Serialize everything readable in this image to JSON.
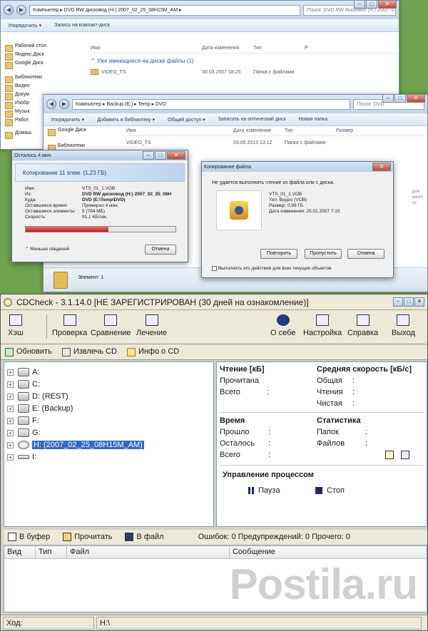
{
  "explorer_back": {
    "address": "Компьютер ▸ DVD RW дисковод (H:) 2007_02_25_08H15M_AM ▸",
    "search": "Поиск: DVD RW дисковод (H:) 2007_0...",
    "cmd": [
      "Упорядочить ▾",
      "Запись на компакт-диск"
    ],
    "sidebar": [
      "Рабочий стол",
      "Яндекс.Диск",
      "Google Диск",
      "Библиотеки",
      "Видео",
      "Докум",
      "Изобр",
      "Музык",
      "Работ",
      "Домаш"
    ],
    "columns": [
      "Имя",
      "Дата изменения",
      "Тип",
      "Р"
    ],
    "group": "Уже имеющиеся на диске файлы (1)",
    "row": {
      "name": "VIDEO_TS",
      "date": "30.03.2007 18:25",
      "type": "Папка с файлами"
    }
  },
  "explorer_front": {
    "address": "Компьютер ▸ Backup (E:) ▸ Temp ▸ DVD",
    "search": "Поиск: DVD",
    "cmd": [
      "Упорядочить ▾",
      "Добавить в библиотеку ▾",
      "Общий доступ ▾",
      "Записать на оптический диск",
      "Новая папка"
    ],
    "sidebar": [
      "Google Диск",
      "Библиотеки"
    ],
    "columns": [
      "Имя",
      "Дата изменения",
      "Тип",
      "Размер"
    ],
    "row": {
      "name": "VIDEO_TS",
      "date": "03.05.2013 13:12",
      "type": "Папка с файлами"
    },
    "status": "Элемент: 1",
    "side_hint": "для\nнного\nто"
  },
  "copy_dialog": {
    "title": "Осталось 4 мин.",
    "header": "Копирование 11 элем. (1,23 ГБ)",
    "labels": [
      "Имя:",
      "Из:",
      "Куда:",
      "Оставшееся время:",
      "Оставшиеся элементы:",
      "Скорость:"
    ],
    "values": [
      "VTS_01_1.VOB",
      "DVD RW дисковод (H:) 2007_02_25_08H",
      "DVD (E:\\Temp\\DVD)",
      "Примерно 4 мин.",
      "5 (784 МБ)",
      "91,1 КБ/сек."
    ],
    "progress": 0.55,
    "less": "Меньше сведений",
    "cancel": "Отмена"
  },
  "error_dialog": {
    "title": "Копирование файла",
    "message": "Не удается выполнить чтение из файла или с диска.",
    "file": "VTS_01_1.VOB",
    "type": "Тип: Видео (VOB)",
    "size": "Размер: 0,99 ГБ",
    "date": "Дата изменения: 25.02.2007 7:15",
    "retry": "Повторить",
    "skip": "Пропустить",
    "cancel": "Отмена",
    "check": "Выполнять это действие для всех текущих объектов"
  },
  "cdcheck": {
    "title": "CDCheck - 3.1.14.0 [НЕ ЗАРЕГИСТРИРОВАН (30 дней на ознакомление)]",
    "toolbar": [
      "Хэш",
      "Проверка",
      "Сравнение",
      "Лечение",
      "О себе",
      "Настройка",
      "Справка",
      "Выход"
    ],
    "toolbar2": [
      "Обновить",
      "Извлечь CD",
      "Инфо о CD"
    ],
    "drives": [
      "A:",
      "C:",
      "D: (REST)",
      "E: (Backup)",
      "F:",
      "G:",
      "H: (2007_02_25_08H15M_AM)",
      "I:"
    ],
    "selected_drive": "H: (2007_02_25_08H15M_AM)",
    "read_title": "Чтение [кБ]",
    "read_rows": [
      "Прочитана",
      "Всего"
    ],
    "speed_title": "Средняя скорость [кБ/с]",
    "speed_rows": [
      "Общая",
      "Чтения",
      "Чистая"
    ],
    "time_title": "Время",
    "time_rows": [
      "Прошло",
      "Осталось",
      "Всего"
    ],
    "stats_title": "Статистика",
    "stats_rows": [
      "Папок",
      "Файлов"
    ],
    "colon": ":",
    "process_title": "Управление процессом",
    "pause": "Пауза",
    "stop": "Стоп",
    "lowbar": [
      "В буфер",
      "Прочитать",
      "В файл"
    ],
    "counts": "Ошибок: 0  Предупреждений: 0  Прочего: 0",
    "log_columns": [
      "Вид",
      "Тип",
      "Файл",
      "Сообщение"
    ],
    "status_label": "Ход:",
    "status_path": "H:\\"
  },
  "watermark": "Postila.ru"
}
